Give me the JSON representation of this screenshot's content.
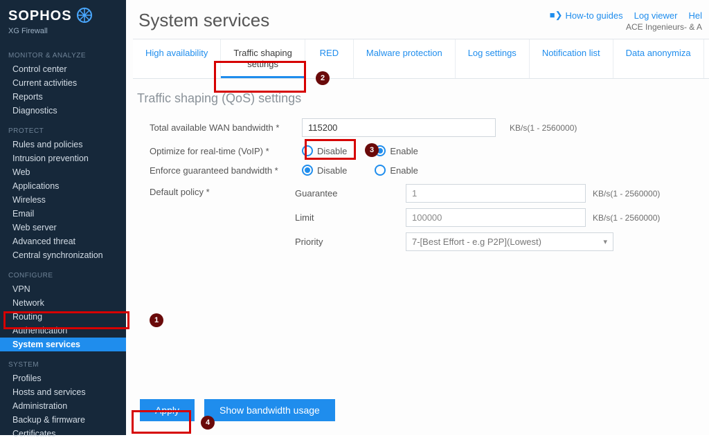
{
  "brand": {
    "name": "SOPHOS",
    "sub": "XG Firewall"
  },
  "topbar": {
    "page_title": "System services",
    "links": {
      "howto": "How-to guides",
      "logviewer": "Log viewer",
      "help": "Hel"
    },
    "org": "ACE Ingenieurs- & A"
  },
  "sidebar": {
    "sections": [
      {
        "title": "MONITOR & ANALYZE",
        "items": [
          "Control center",
          "Current activities",
          "Reports",
          "Diagnostics"
        ]
      },
      {
        "title": "PROTECT",
        "items": [
          "Rules and policies",
          "Intrusion prevention",
          "Web",
          "Applications",
          "Wireless",
          "Email",
          "Web server",
          "Advanced threat",
          "Central synchronization"
        ]
      },
      {
        "title": "CONFIGURE",
        "items": [
          "VPN",
          "Network",
          "Routing",
          "Authentication",
          "System services"
        ],
        "active_index": 4
      },
      {
        "title": "SYSTEM",
        "items": [
          "Profiles",
          "Hosts and services",
          "Administration",
          "Backup & firmware",
          "Certificates"
        ]
      }
    ]
  },
  "tabs": {
    "items": [
      "High availability",
      "Traffic shaping settings",
      "RED",
      "Malware protection",
      "Log settings",
      "Notification list",
      "Data anonymiza"
    ],
    "active_index": 1
  },
  "section_title": "Traffic shaping (QoS) settings",
  "form": {
    "total_wan_label": "Total available WAN bandwidth *",
    "total_wan_value": "115200",
    "total_wan_hint": "KB/s(1 - 2560000)",
    "optimize_label": "Optimize for real-time (VoIP) *",
    "optimize_value": "Enable",
    "enforce_label": "Enforce guaranteed bandwidth *",
    "enforce_value": "Disable",
    "radio_disable": "Disable",
    "radio_enable": "Enable",
    "default_policy_label": "Default policy *",
    "policy": {
      "guarantee_label": "Guarantee",
      "guarantee_value": "1",
      "guarantee_hint": "KB/s(1 - 2560000)",
      "limit_label": "Limit",
      "limit_value": "100000",
      "limit_hint": "KB/s(1 - 2560000)",
      "priority_label": "Priority",
      "priority_value": "7-[Best Effort - e.g P2P](Lowest)"
    }
  },
  "buttons": {
    "apply": "Apply",
    "show_bw": "Show bandwidth usage"
  },
  "annotations": {
    "n1": "1",
    "n2": "2",
    "n3": "3",
    "n4": "4"
  }
}
